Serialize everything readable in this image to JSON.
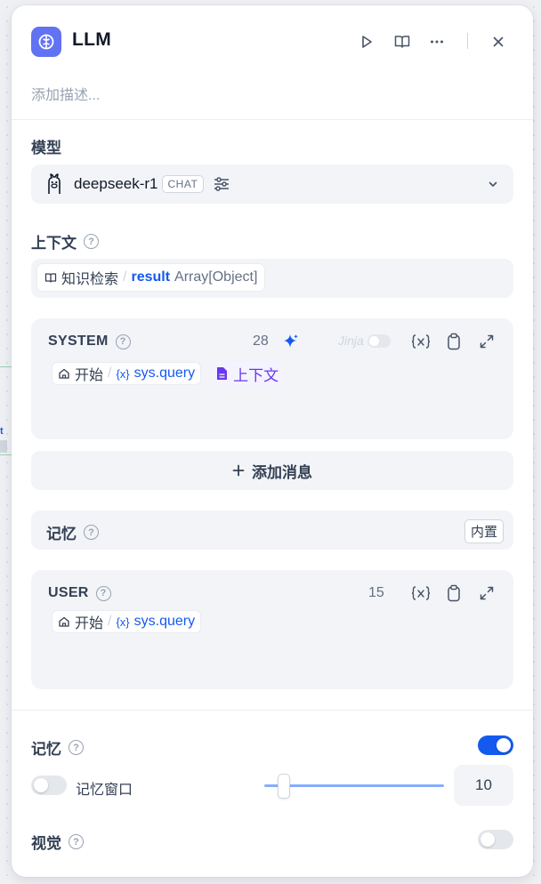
{
  "panel": {
    "title": "LLM",
    "description_placeholder": "添加描述..."
  },
  "model": {
    "label": "模型",
    "name": "deepseek-r1",
    "mode_badge": "CHAT"
  },
  "context": {
    "label": "上下文",
    "chip": {
      "knowledge": "知识检索",
      "sep": "/",
      "var": "result",
      "type": "Array[Object]"
    }
  },
  "system_prompt": {
    "role": "SYSTEM",
    "token_count": "28",
    "jinja_label": "Jinja",
    "var_chip": {
      "node": "开始",
      "sep": "/",
      "x": "{x}",
      "var": "sys.query"
    },
    "context_tag": "上下文"
  },
  "add_message": {
    "label": "添加消息"
  },
  "memory_row": {
    "label": "记忆",
    "badge": "内置"
  },
  "user_prompt": {
    "role": "USER",
    "token_count": "15",
    "var_chip": {
      "node": "开始",
      "sep": "/",
      "x": "{x}",
      "var": "sys.query"
    }
  },
  "memory": {
    "label": "记忆",
    "enabled": true,
    "window_label": "记忆窗口",
    "window_enabled": false,
    "window_value": "10",
    "window_slider_fraction": 0.1
  },
  "vision": {
    "label": "视觉",
    "enabled": false
  },
  "colors": {
    "accent": "#155aef",
    "icon_bg": "#6172f3",
    "context_purple": "#6938ef"
  },
  "icons": [
    "llm-brain-icon",
    "run-icon",
    "docs-icon",
    "more-icon",
    "close-icon",
    "help-icon",
    "model-logo-icon",
    "settings-sliders-icon",
    "chevron-down-icon",
    "book-icon",
    "sparkle-icon",
    "variable-icon",
    "copy-icon",
    "expand-icon",
    "home-icon",
    "file-icon",
    "plus-icon"
  ]
}
